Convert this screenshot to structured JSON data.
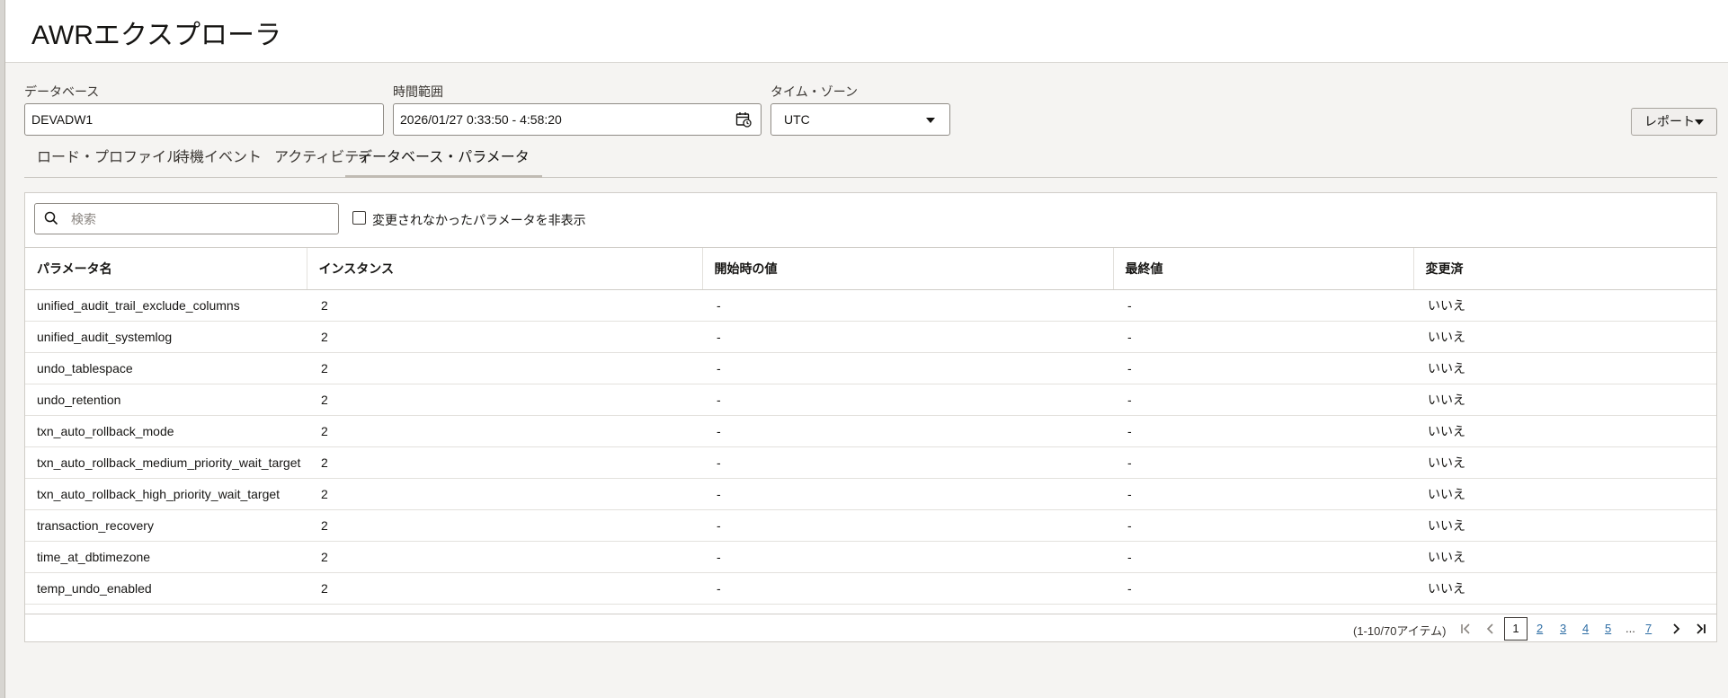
{
  "app": {
    "title": "AWRエクスプローラ"
  },
  "filters": {
    "database_label": "データベース",
    "database_value": "DEVADW1",
    "time_range_label": "時間範囲",
    "time_range_value": "2026/01/27 0:33:50 - 4:58:20",
    "timezone_label": "タイム・ゾーン",
    "timezone_value": "UTC"
  },
  "toolbar": {
    "report_label": "レポート"
  },
  "tabs": [
    {
      "label": "ロード・プロファイル",
      "active": false
    },
    {
      "label": "待機イベント",
      "active": false
    },
    {
      "label": "アクティビティ",
      "active": false
    },
    {
      "label": "データベース・パラメータ",
      "active": true
    }
  ],
  "search": {
    "placeholder": "検索",
    "value": ""
  },
  "hide_unchanged": {
    "label": "変更されなかったパラメータを非表示",
    "checked": false
  },
  "table": {
    "columns": [
      "パラメータ名",
      "インスタンス",
      "開始時の値",
      "最終値",
      "変更済"
    ],
    "rows": [
      [
        "unified_audit_trail_exclude_columns",
        "2",
        "-",
        "-",
        "いいえ"
      ],
      [
        "unified_audit_systemlog",
        "2",
        "-",
        "-",
        "いいえ"
      ],
      [
        "undo_tablespace",
        "2",
        "-",
        "-",
        "いいえ"
      ],
      [
        "undo_retention",
        "2",
        "-",
        "-",
        "いいえ"
      ],
      [
        "txn_auto_rollback_mode",
        "2",
        "-",
        "-",
        "いいえ"
      ],
      [
        "txn_auto_rollback_medium_priority_wait_target",
        "2",
        "-",
        "-",
        "いいえ"
      ],
      [
        "txn_auto_rollback_high_priority_wait_target",
        "2",
        "-",
        "-",
        "いいえ"
      ],
      [
        "transaction_recovery",
        "2",
        "-",
        "-",
        "いいえ"
      ],
      [
        "time_at_dbtimezone",
        "2",
        "-",
        "-",
        "いいえ"
      ],
      [
        "temp_undo_enabled",
        "2",
        "-",
        "-",
        "いいえ"
      ]
    ]
  },
  "pagination": {
    "info": "(1-10/70アイテム)",
    "current": "1",
    "pages": [
      "2",
      "3",
      "4",
      "5"
    ],
    "ellipsis": "...",
    "last": "7"
  },
  "icons": {
    "search": "search-icon",
    "calendar": "calendar-icon",
    "dropdown": "chevron-down-icon",
    "first": "first-page-icon",
    "prev": "prev-page-icon",
    "next": "next-page-icon",
    "last": "last-page-icon"
  },
  "colors": {
    "link": "#2f6ea5",
    "background": "#f5f4f2"
  }
}
